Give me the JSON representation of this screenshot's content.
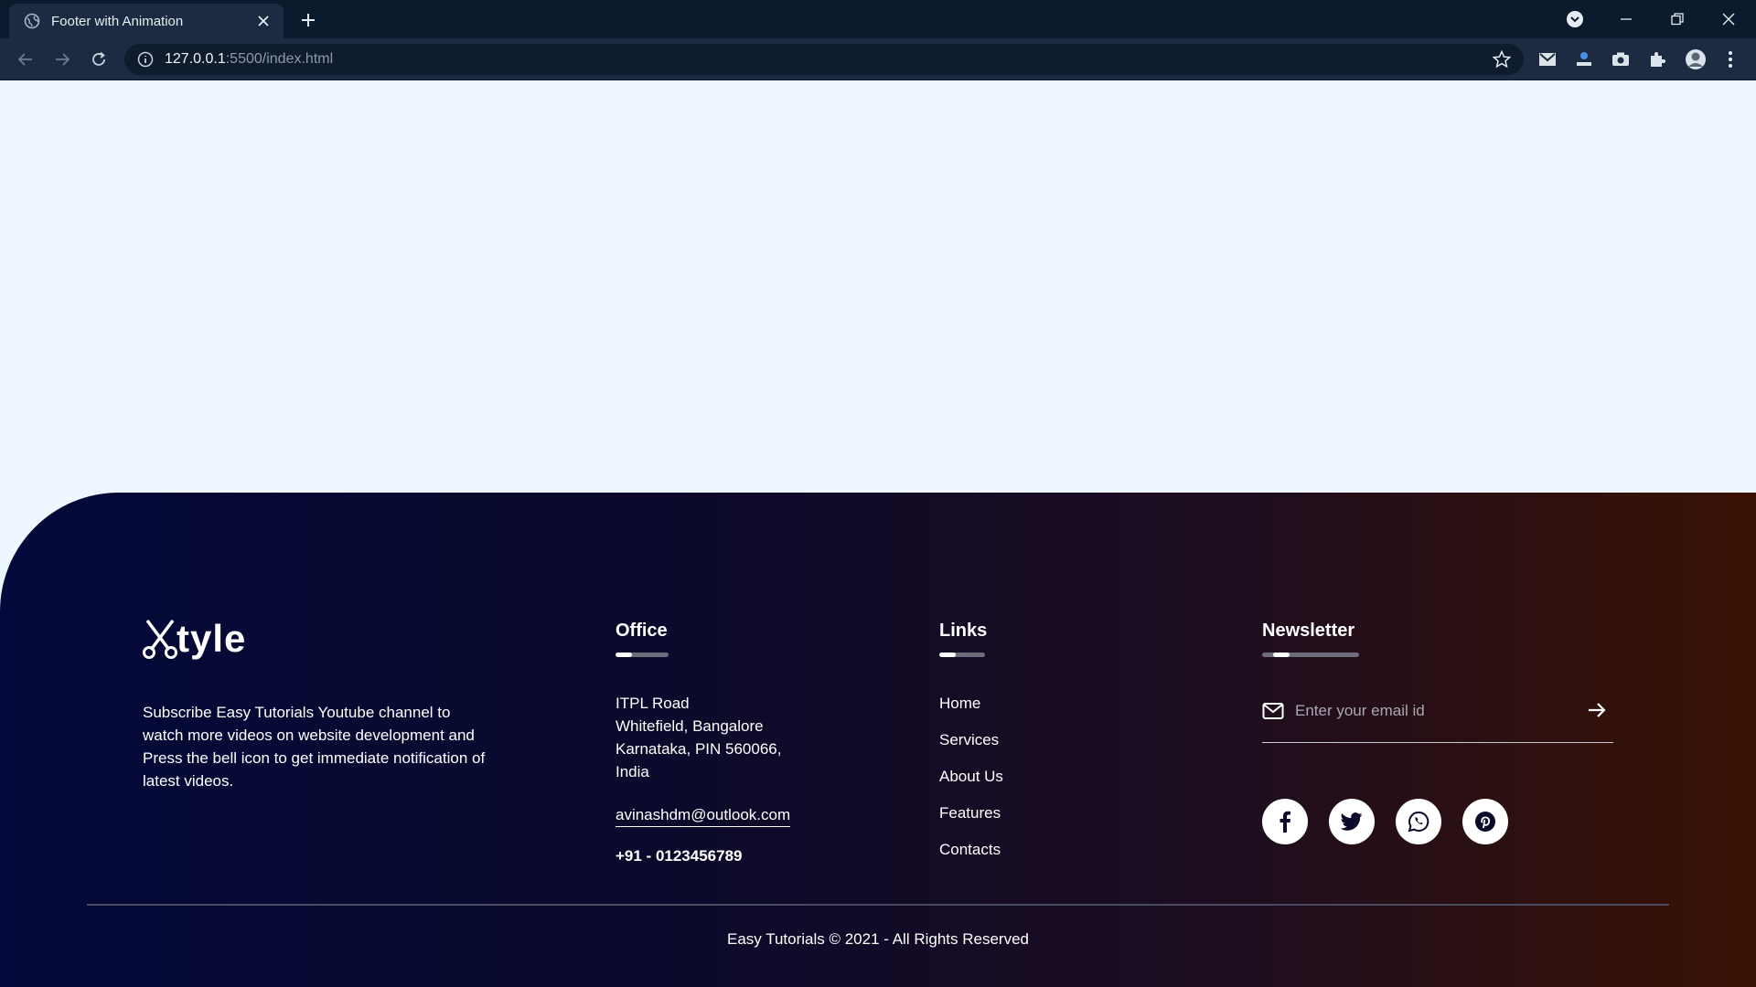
{
  "browser": {
    "tab_title": "Footer with Animation",
    "url_host": "127.0.0.1",
    "url_path": ":5500/index.html"
  },
  "footer": {
    "brand": "tyle",
    "about": "Subscribe Easy Tutorials Youtube channel to watch more videos on website development and Press the bell icon to get immediate notification of latest videos.",
    "office": {
      "title": "Office",
      "line1": "ITPL Road",
      "line2": "Whitefield, Bangalore",
      "line3": "Karnataka, PIN 560066,",
      "line4": "India",
      "email": "avinashdm@outlook.com",
      "phone": "+91 - 0123456789"
    },
    "links": {
      "title": "Links",
      "items": [
        "Home",
        "Services",
        "About Us",
        "Features",
        "Contacts"
      ]
    },
    "newsletter": {
      "title": "Newsletter",
      "placeholder": "Enter your email id",
      "socials": [
        "facebook-icon",
        "twitter-icon",
        "whatsapp-icon",
        "pinterest-icon"
      ]
    },
    "copyright": "Easy Tutorials © 2021 - All Rights Reserved"
  },
  "colors": {
    "footer_gradient_start": "#03093a",
    "footer_gradient_end": "#3a1204",
    "page_background": "#eef7ff"
  }
}
